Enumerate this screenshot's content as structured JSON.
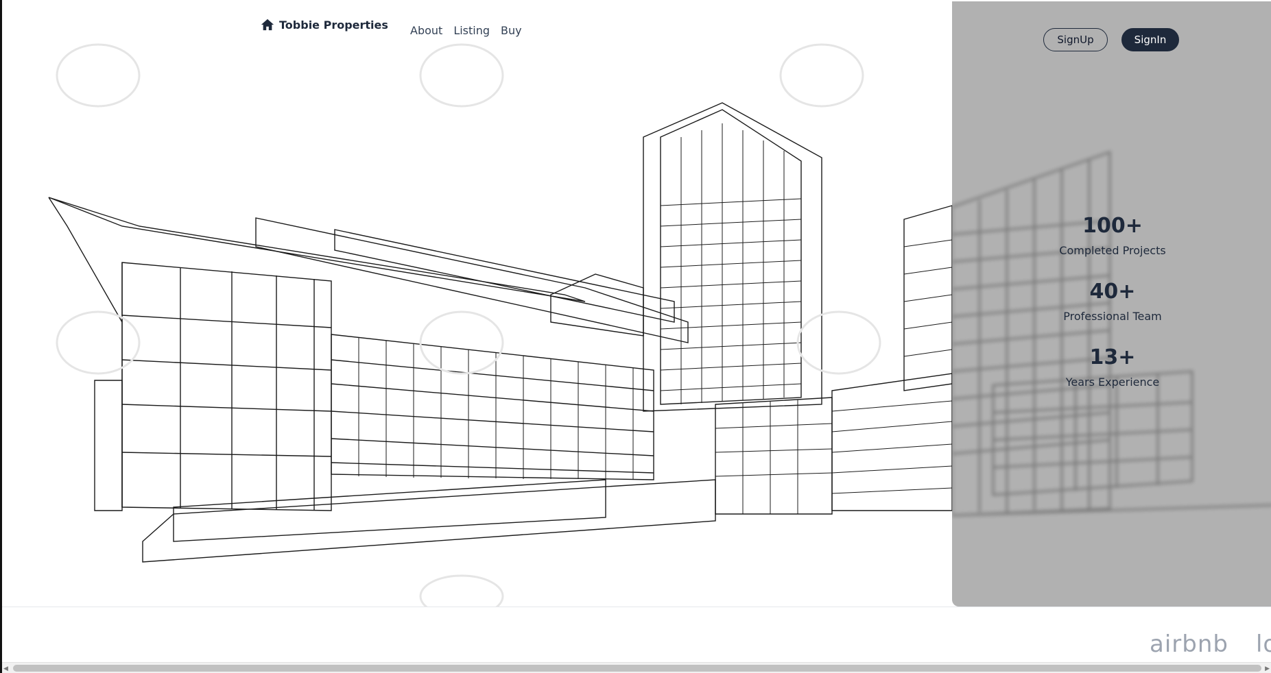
{
  "brand": {
    "name": "Tobbie Properties",
    "icon": "home-icon"
  },
  "nav": {
    "links": [
      "About",
      "Listing",
      "Buy"
    ]
  },
  "auth": {
    "signup_label": "SignUp",
    "signin_label": "SignIn"
  },
  "stats": [
    {
      "value": "100+",
      "label": "Completed Projects"
    },
    {
      "value": "40+",
      "label": "Professional Team"
    },
    {
      "value": "13+",
      "label": "Years Experience"
    }
  ],
  "partners": [
    "airbnb",
    "lo"
  ],
  "hero_image": {
    "description_icon": "building-sketch-image"
  },
  "colors": {
    "primary": "#1e293b",
    "panel": "#a0a0a0",
    "partner_text": "#9ca3af"
  }
}
